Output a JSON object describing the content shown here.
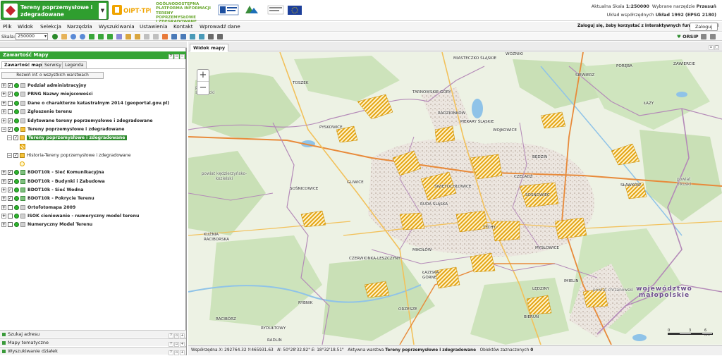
{
  "header": {
    "app_title": "Tereny poprzemysłowe i zdegradowane",
    "logo_small": "OIPT·TPP",
    "logo_text_lines": [
      "OGÓLNODOSTĘPNA",
      "PLATFORMA INFORMACJI",
      "TERENY POPRZEMYSŁOWE",
      "I ZDEGRADOWANE"
    ],
    "right_line1_prefix": "Aktualna Skala",
    "right_line1_scale": "1:250000",
    "right_line1_tool_prefix": "Wybrane narzędzie",
    "right_line1_tool": "Przesuń",
    "right_line2_prefix": "Układ współrzędnych",
    "right_line2_value": "Układ 1992 (EPSG 2180)"
  },
  "menu": {
    "items": [
      "Plik",
      "Widok",
      "Selekcja",
      "Narzędzia",
      "Wyszukiwania",
      "Ustawienia",
      "Kontakt",
      "Wprowadź dane"
    ],
    "login_hint": "Zaloguj się, żeby korzystać z interaktywnych funkcji aplikacji",
    "login_button": "Zaloguj"
  },
  "toolbar": {
    "scale_label": "Skala:",
    "scale_value": "250000",
    "orsip": "ORSIP"
  },
  "left_panel": {
    "title": "Zawartość Mapy",
    "tabs": [
      "Zawartość mapy",
      "Serwisy",
      "Legenda"
    ],
    "expand_button": "Rozwiń inf. o wszystkich warstwach",
    "layers": [
      "Podział administracyjny",
      "PRNG Nazwy miejscowości",
      "Dane o charakterze katastralnym 2014 (geoportal.gov.pl)",
      "Zgłoszenie terenu",
      "Edytowane tereny poprzemysłowe i zdegradowane",
      "Tereny poprzemysłowe i zdegradowane",
      "Tereny poprzemysłowe i zdegradowane",
      "Historia-Tereny poprzemysłowe i zdegradowane",
      "BDOT10k - Sieć Komunikacyjna",
      "BDOT10k - Budynki i Zabudowa",
      "BDOT10k - Sieć Wodna",
      "BDOT10k - Pokrycie Terenu",
      "Ortofotomapa 2009",
      "ISOK cieniowanie - numeryczny model terenu",
      "Numeryczny Model Terenu"
    ],
    "bottom_items": [
      "Szukaj adresu",
      "Mapy tematyczne",
      "Wyszukiwanie działek"
    ]
  },
  "map": {
    "tab": "Widok mapy",
    "zoom_in": "+",
    "zoom_out": "−",
    "places": [
      "MIASTECZKO ŚLĄSKIE",
      "WOŹNIKI",
      "PORĘBA",
      "ZAWIERCIE",
      "SIEWIERZ",
      "ŁAZY",
      "TOSZEK",
      "TARNOWSKIE GÓRY",
      "RADZIONKÓW",
      "PIEKARY ŚLĄSKIE",
      "WOJKOWICE",
      "PYSKOWICE",
      "BĘDZIN",
      "CZELADŹ",
      "SOSNOWIEC",
      "SŁAWKÓW",
      "GLIWICE",
      "ŚWIĘTOCHŁOWICE",
      "RUDA ŚLĄSKA",
      "SOŚNICOWICE",
      "MYSŁOWICE",
      "KUŹNIA RACIBORSKA",
      "MIKOŁÓW",
      "CZERWIONKA-LESZCZYNY",
      "ŁAZISKA GÓRNE",
      "IMIELIN",
      "LĘDZINY",
      "ORZESZE",
      "RYBNIK",
      "RACIBÓRZ",
      "RYDUŁTOWY",
      "BIERUŃ",
      "RADLIN",
      "TYCHY"
    ],
    "districts": [
      "powiat strzelecki",
      "powiat kędzierzyńsko-kozielski",
      "powiat olkuski",
      "powiat chrzanowski"
    ],
    "region": "województwo małopolskie",
    "scalebar_labels": [
      "0",
      "3",
      "6 km"
    ]
  },
  "status": {
    "coords_label": "Współrzędna",
    "x_label": "X:",
    "x_value": "292764.32",
    "y_label": "Y:",
    "y_value": "465931.63",
    "n_label": "N:",
    "n_value": "50°28'32.82\"",
    "e_label": "E:",
    "e_value": "18°32'18.51\"",
    "active_label": "Aktywna warstwa",
    "active_value": "Tereny poprzemysłowe i zdegradowane",
    "selected_label": "Obiektów zaznaczonych",
    "selected_value": "0"
  },
  "colors": {
    "brand_green": "#2f9e2f",
    "hatched_area": "#f3b822",
    "boundary": "#b48ab8"
  }
}
